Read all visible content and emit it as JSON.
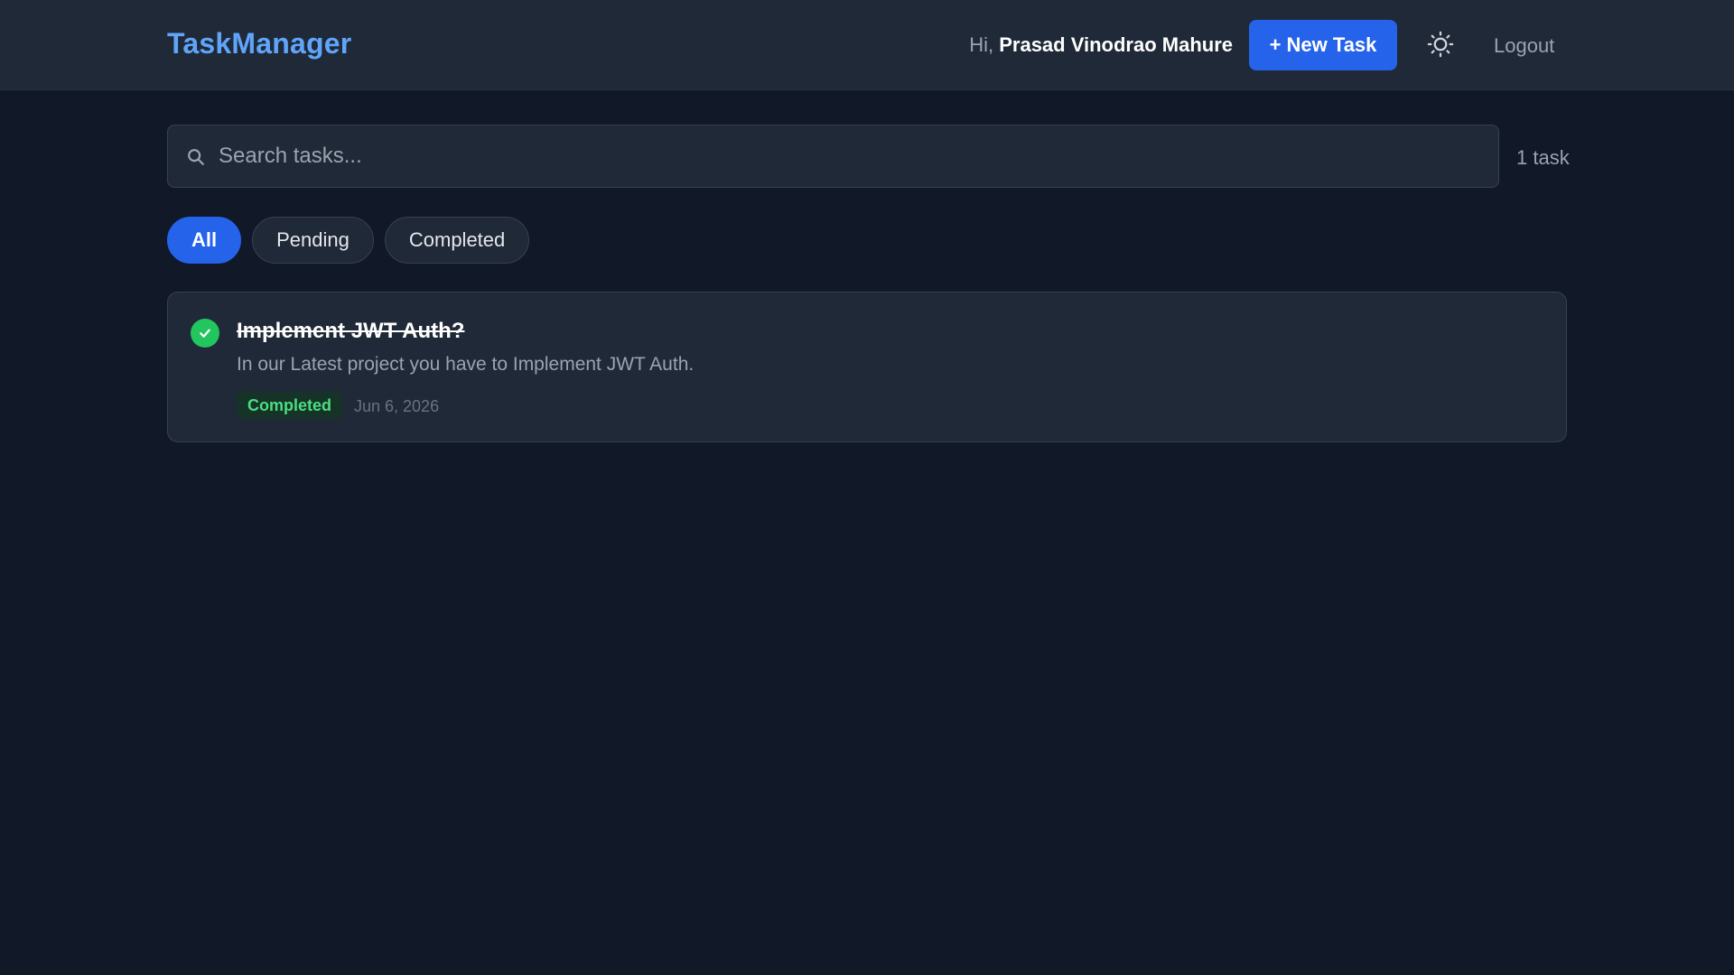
{
  "app": {
    "title": "TaskManager"
  },
  "header": {
    "greeting_prefix": "Hi, ",
    "user_name": "Prasad Vinodrao Mahure",
    "new_task_label": "+ New Task",
    "theme_icon": "sun-icon",
    "logout_label": "Logout"
  },
  "search": {
    "placeholder": "Search tasks...",
    "value": "",
    "icon": "search-icon"
  },
  "task_count": "1 task",
  "filters": [
    {
      "label": "All",
      "active": true
    },
    {
      "label": "Pending",
      "active": false
    },
    {
      "label": "Completed",
      "active": false
    }
  ],
  "tasks": [
    {
      "title": "Implement JWT Auth?",
      "description": "In our Latest project you have to Implement JWT Auth.",
      "status": "Completed",
      "date": "Jun 6, 2026",
      "completed": true
    }
  ],
  "colors": {
    "background": "#111827",
    "surface": "#1f2937",
    "accent": "#2563eb",
    "brand": "#60a5fa",
    "success": "#22c55e"
  }
}
